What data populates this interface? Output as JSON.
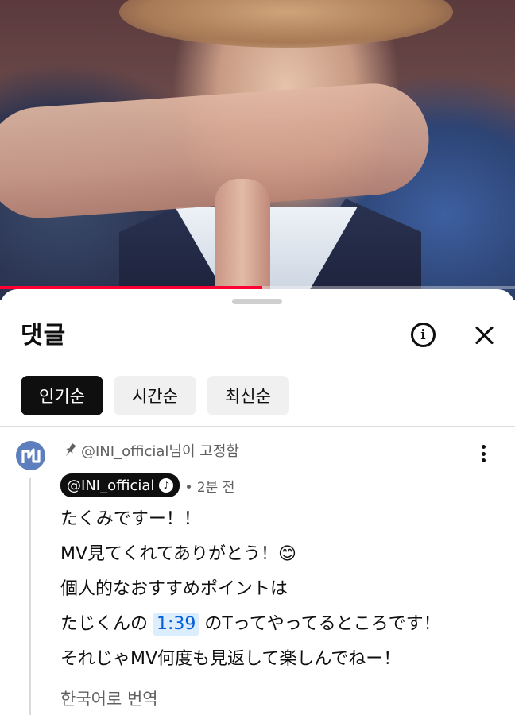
{
  "player": {
    "progress_fraction": 0.51,
    "progress_color": "#ff0033"
  },
  "sheet": {
    "title": "댓글",
    "info_icon": "info-circle-icon",
    "close_icon": "close-icon"
  },
  "sort_chips": [
    {
      "label": "인기순",
      "active": true
    },
    {
      "label": "시간순",
      "active": false
    },
    {
      "label": "최신순",
      "active": false
    }
  ],
  "comment": {
    "avatar_icon": "channel-avatar-icon",
    "pinned_text": "@INI_official님이 고정함",
    "author": "@INI_official",
    "author_badge_icon": "music-note-icon",
    "time": "• 2분 전",
    "lines": [
      "たくみですー！！",
      "MV見てくれてありがとう！😊",
      "個人的なおすすめポイントは"
    ],
    "line4_before": "たじくんの",
    "timestamp": "1:39",
    "line4_after": "のTってやってるところです！",
    "line5": "それじゃMV何度も見返して楽しんでねー！",
    "translate_label": "한국어로 번역"
  },
  "colors": {
    "link": "#065fd4",
    "link_bg": "#dceefd",
    "active_chip": "#0f0f0f",
    "avatar": "#5d7fbd"
  }
}
